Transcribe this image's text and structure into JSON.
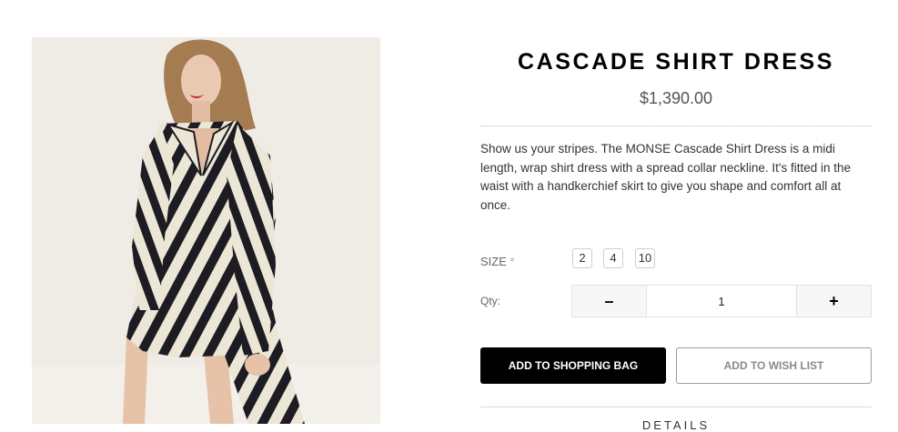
{
  "product": {
    "title": "CASCADE SHIRT DRESS",
    "price": "$1,390.00",
    "description": "Show us your stripes. The MONSE Cascade Shirt Dress is a midi length, wrap shirt dress with a spread collar neckline. It's fitted in the waist with a handkerchief skirt to give you shape and comfort all at once.",
    "image_alt": "Model wearing black and white striped wrap shirt dress"
  },
  "size": {
    "label": "SIZE",
    "required_mark": "*",
    "options": [
      "2",
      "4",
      "10"
    ]
  },
  "quantity": {
    "label": "Qty:",
    "minus": "–",
    "plus": "+",
    "value": "1"
  },
  "actions": {
    "add_to_bag": "ADD TO SHOPPING BAG",
    "add_to_wishlist": "ADD TO WISH LIST"
  },
  "details_tab": "DETAILS",
  "colors": {
    "button_primary": "#000000",
    "photo_background": "#efebe5",
    "stripe_dark": "#1c1c22",
    "stripe_light": "#ece6d6"
  }
}
